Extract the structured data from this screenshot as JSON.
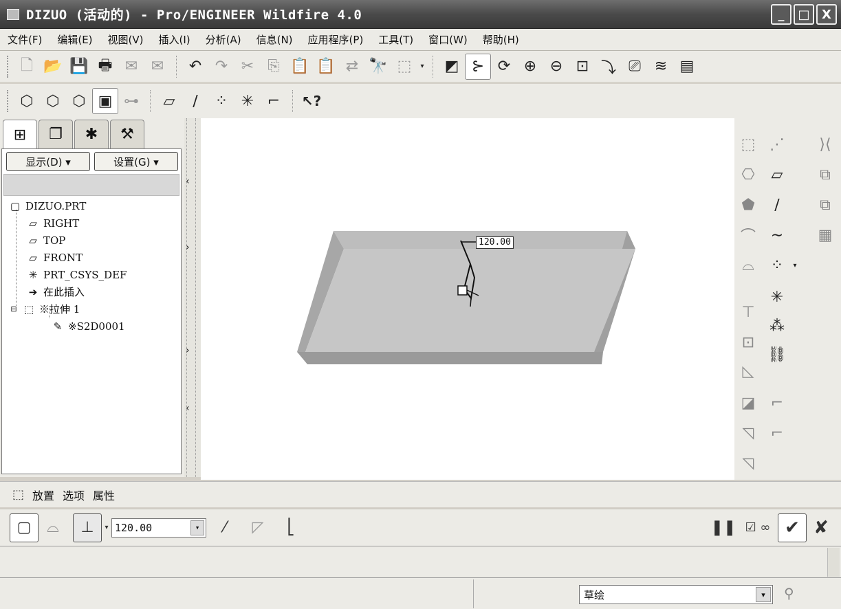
{
  "window": {
    "title": "DIZUO (活动的) - Pro/ENGINEER Wildfire 4.0",
    "buttons": [
      "_",
      "□",
      "X"
    ]
  },
  "menubar": {
    "items": [
      "文件(F)",
      "编辑(E)",
      "视图(V)",
      "插入(I)",
      "分析(A)",
      "信息(N)",
      "应用程序(P)",
      "工具(T)",
      "窗口(W)",
      "帮助(H)"
    ]
  },
  "toolbar2": {
    "context_help": "?"
  },
  "model_tree": {
    "show_button": "显示(D) ▾",
    "settings_button": "设置(G) ▾",
    "items": [
      "DIZUO.PRT",
      "RIGHT",
      "TOP",
      "FRONT",
      "PRT_CSYS_DEF",
      "在此插入",
      "※拉伸 1",
      "※S2D0001"
    ]
  },
  "graphics": {
    "dimension": "120.00"
  },
  "dashboard": {
    "tabs": [
      "放置",
      "选项",
      "属性"
    ],
    "depth_value": "120.00"
  },
  "status": {
    "filter": "草绘"
  }
}
